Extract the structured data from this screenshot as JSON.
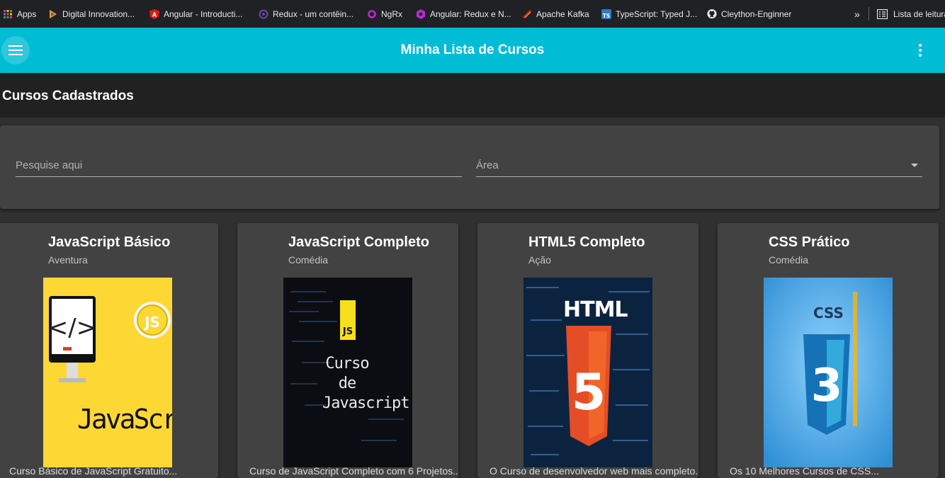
{
  "bookmarks": {
    "items": [
      {
        "label": "Apps",
        "icon": "apps-grid-icon"
      },
      {
        "label": "Digital Innovation...",
        "icon": "dio-icon"
      },
      {
        "label": "Angular - Introducti...",
        "icon": "angular-icon"
      },
      {
        "label": "Redux - um contêin...",
        "icon": "redux-icon"
      },
      {
        "label": "NgRx",
        "icon": "ngrx-icon"
      },
      {
        "label": "Angular: Redux e N...",
        "icon": "ngrx-icon"
      },
      {
        "label": "Apache Kafka",
        "icon": "kafka-icon"
      },
      {
        "label": "TypeScript: Typed J...",
        "icon": "typescript-icon"
      },
      {
        "label": "Cleython-Enginner",
        "icon": "github-icon"
      }
    ],
    "more": "»",
    "reading_list": "Lista de leitura"
  },
  "toolbar": {
    "title": "Minha Lista de Cursos",
    "menu_icon": "hamburger-menu-icon",
    "options_icon": "more-vertical-icon",
    "color": "#00bcd4"
  },
  "header": {
    "title": "Cursos Cadastrados"
  },
  "filters": {
    "search_placeholder": "Pesquise aqui",
    "area_placeholder": "Área"
  },
  "courses": [
    {
      "title": "JavaScript Básico",
      "subtitle": "Aventura",
      "image_text": "JavaScript",
      "badge": "JS",
      "desc": "Curso Básico de JavaScript Gratuito..."
    },
    {
      "title": "JavaScript Completo",
      "subtitle": "Comédia",
      "image_text": "Curso de Javascript",
      "badge": "JS",
      "desc": "Curso de JavaScript Completo com 6 Projetos..."
    },
    {
      "title": "HTML5 Completo",
      "subtitle": "Ação",
      "image_text": "HTML",
      "badge": "5",
      "desc": "O Curso de desenvolvedor web mais completo..."
    },
    {
      "title": "CSS Prático",
      "subtitle": "Comédia",
      "image_text": "CSS",
      "badge": "3",
      "desc": "Os 10 Melhores Cursos de CSS..."
    }
  ]
}
